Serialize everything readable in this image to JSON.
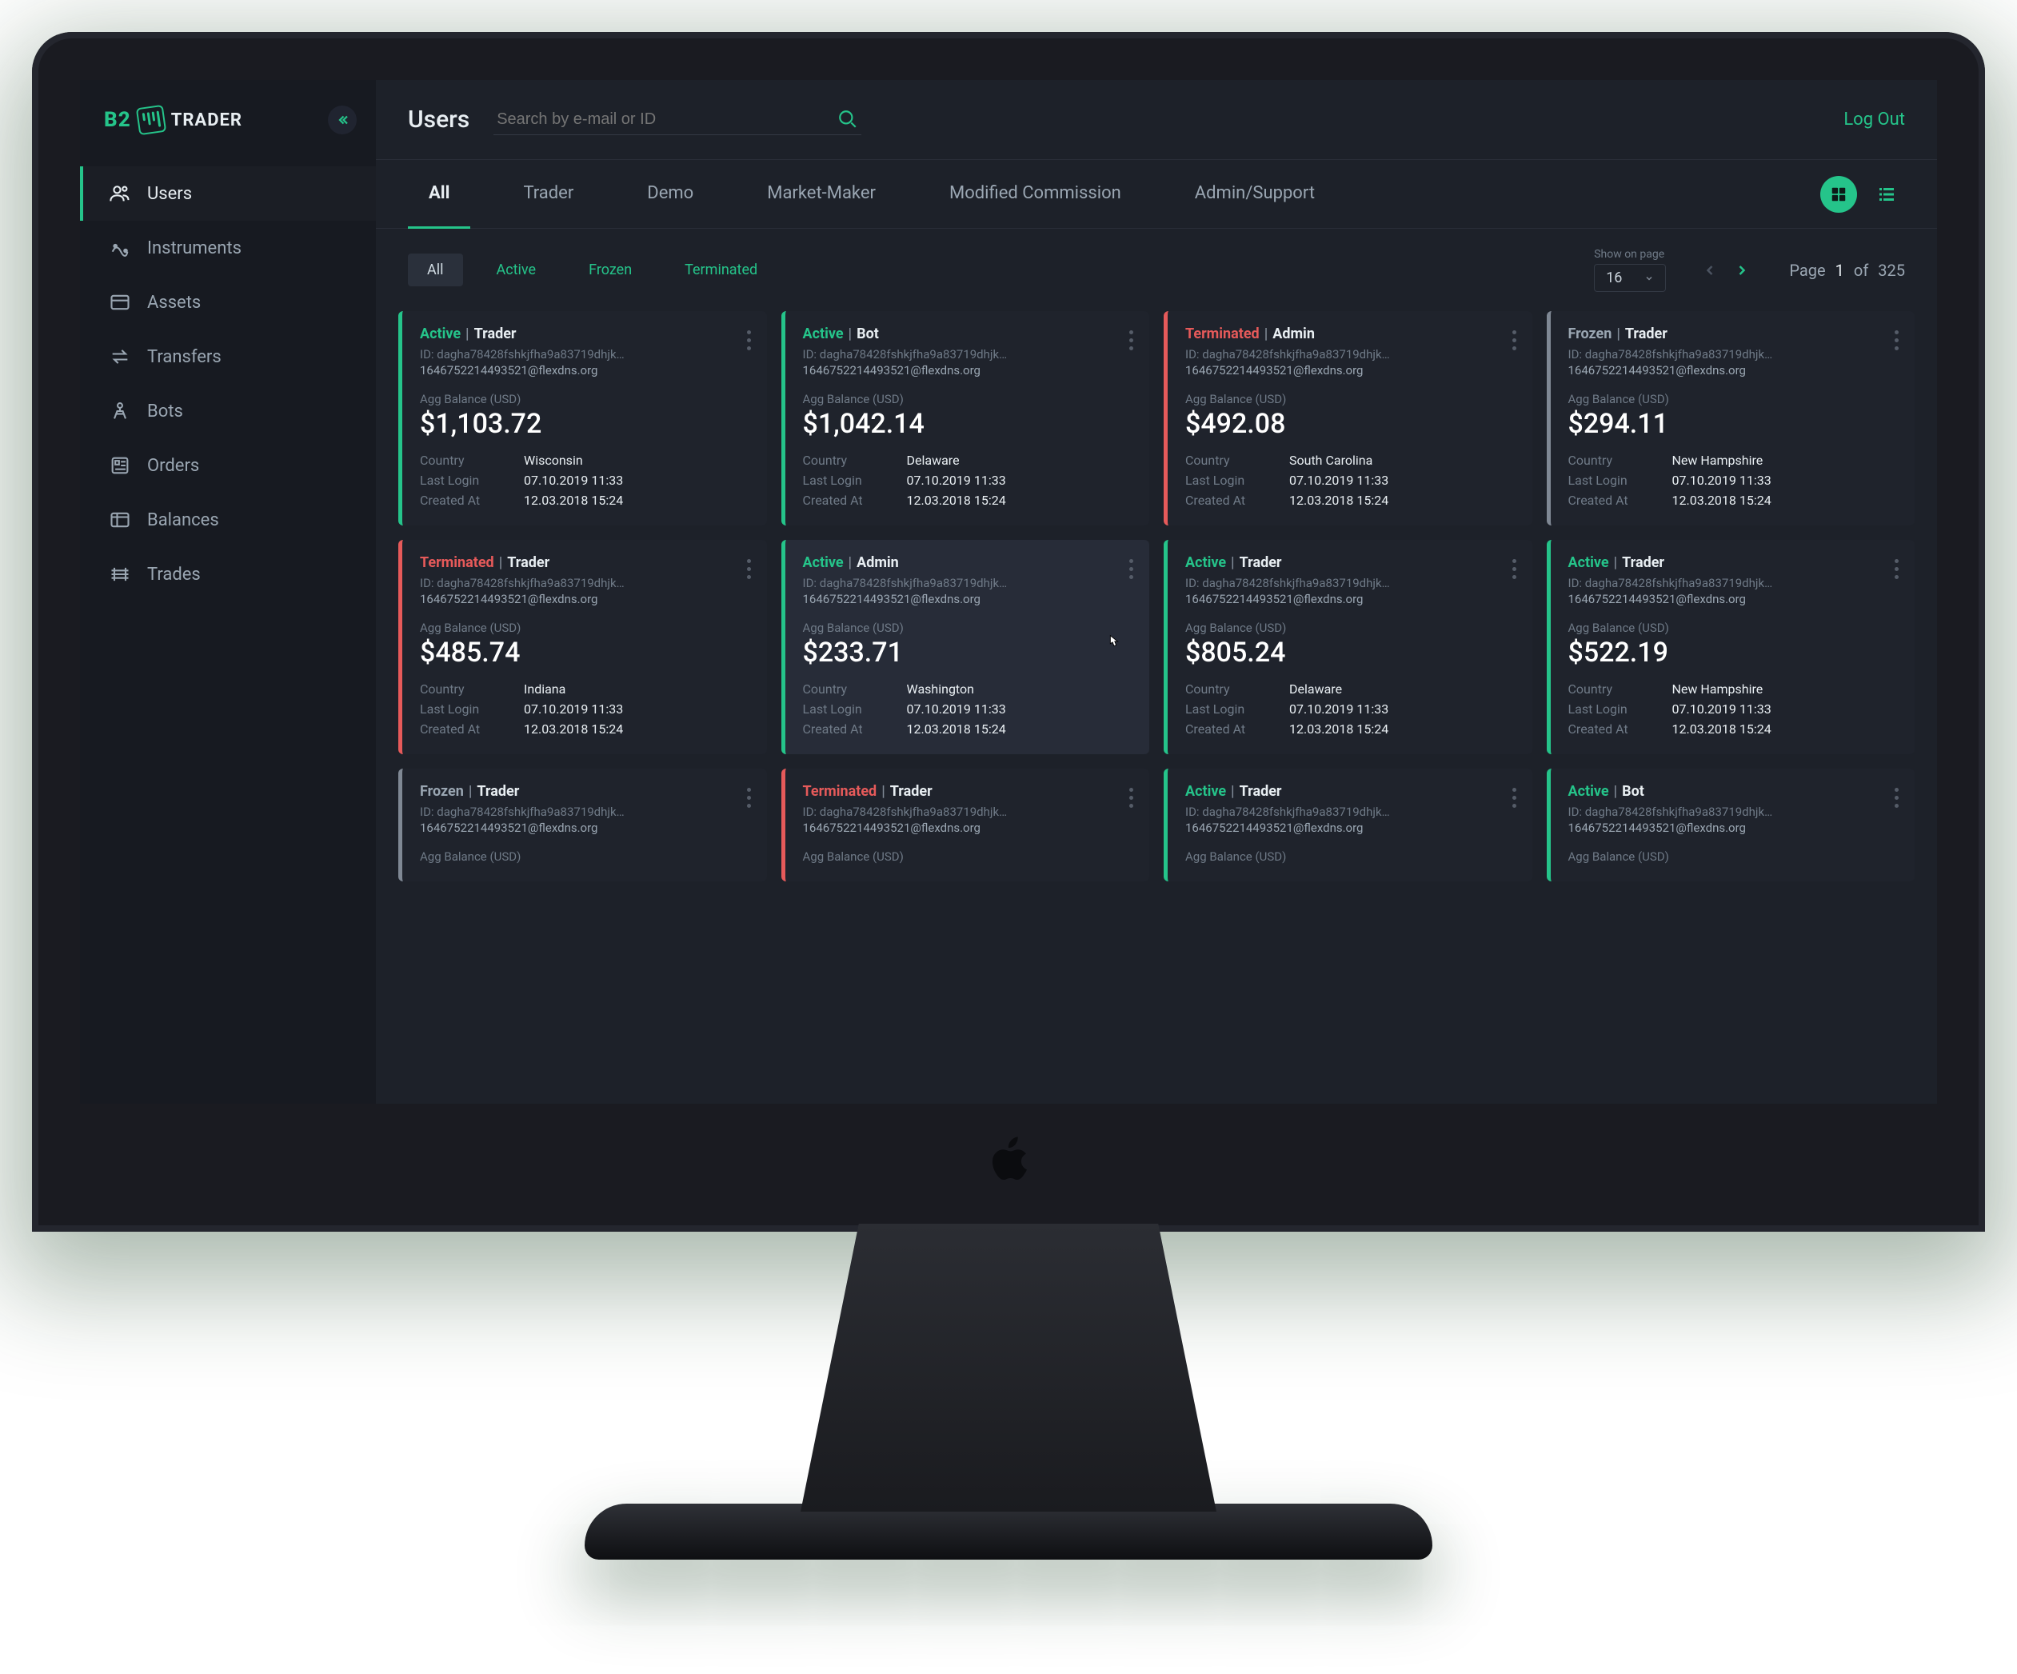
{
  "brand": {
    "b2": "B2",
    "trader": "TRADER"
  },
  "sidebar": {
    "items": [
      {
        "label": "Users",
        "icon": "users-icon",
        "active": true
      },
      {
        "label": "Instruments",
        "icon": "instruments-icon"
      },
      {
        "label": "Assets",
        "icon": "assets-icon"
      },
      {
        "label": "Transfers",
        "icon": "transfers-icon"
      },
      {
        "label": "Bots",
        "icon": "bots-icon"
      },
      {
        "label": "Orders",
        "icon": "orders-icon"
      },
      {
        "label": "Balances",
        "icon": "balances-icon"
      },
      {
        "label": "Trades",
        "icon": "trades-icon"
      }
    ]
  },
  "header": {
    "title": "Users",
    "search_placeholder": "Search by e-mail or ID",
    "logout": "Log Out"
  },
  "tabs": [
    "All",
    "Trader",
    "Demo",
    "Market-Maker",
    "Modified Commission",
    "Admin/Support"
  ],
  "filters": [
    "All",
    "Active",
    "Frozen",
    "Terminated"
  ],
  "pagination": {
    "show_label": "Show on page",
    "page_size": "16",
    "page_word": "Page",
    "current": "1",
    "of_word": "of",
    "total": "325"
  },
  "labels": {
    "id_prefix": "ID:",
    "balance_label": "Agg Balance (USD)",
    "country": "Country",
    "last_login": "Last Login",
    "created_at": "Created At"
  },
  "common": {
    "id": "dagha78428fshkjfha9a83719dhjk…",
    "email": "1646752214493521@flexdns.org",
    "last_login": "07.10.2019 11:33",
    "created_at": "12.03.2018 15:24"
  },
  "cards": [
    {
      "status": "Active",
      "st_cls": "st-active",
      "border": "lime",
      "role": "Trader",
      "balance": "$1,103.72",
      "country": "Wisconsin"
    },
    {
      "status": "Active",
      "st_cls": "st-active",
      "border": "lime",
      "role": "Bot",
      "balance": "$1,042.14",
      "country": "Delaware"
    },
    {
      "status": "Terminated",
      "st_cls": "st-term",
      "border": "red",
      "role": "Admin",
      "balance": "$492.08",
      "country": "South Carolina"
    },
    {
      "status": "Frozen",
      "st_cls": "st-frozen",
      "border": "gray",
      "role": "Trader",
      "balance": "$294.11",
      "country": "New Hampshire"
    },
    {
      "status": "Terminated",
      "st_cls": "st-term",
      "border": "red",
      "role": "Trader",
      "balance": "$485.74",
      "country": "Indiana"
    },
    {
      "status": "Active",
      "st_cls": "st-active",
      "border": "lime",
      "role": "Admin",
      "balance": "$233.71",
      "country": "Washington",
      "hover": true
    },
    {
      "status": "Active",
      "st_cls": "st-active",
      "border": "lime",
      "role": "Trader",
      "balance": "$805.24",
      "country": "Delaware"
    },
    {
      "status": "Active",
      "st_cls": "st-active",
      "border": "lime",
      "role": "Trader",
      "balance": "$522.19",
      "country": "New Hampshire"
    },
    {
      "status": "Frozen",
      "st_cls": "st-frozen",
      "border": "gray",
      "role": "Trader",
      "partial": true
    },
    {
      "status": "Terminated",
      "st_cls": "st-term",
      "border": "red",
      "role": "Trader",
      "partial": true
    },
    {
      "status": "Active",
      "st_cls": "st-active",
      "border": "lime",
      "role": "Trader",
      "partial": true
    },
    {
      "status": "Active",
      "st_cls": "st-active",
      "border": "lime",
      "role": "Bot",
      "partial": true
    }
  ],
  "colors": {
    "accent": "#25c48a",
    "danger": "#e65a5a",
    "muted": "#7f8894"
  }
}
